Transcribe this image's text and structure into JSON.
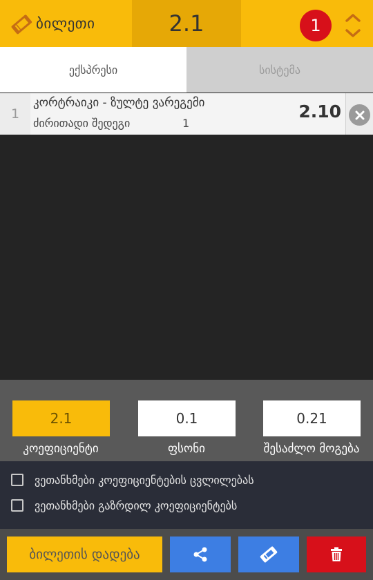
{
  "header": {
    "title": "ბილეთი",
    "total_odds": "2.1",
    "bet_count": "1"
  },
  "tabs": [
    {
      "label": "ექსპრესი",
      "active": true
    },
    {
      "label": "სისტემა",
      "active": false
    }
  ],
  "bets": [
    {
      "index": "1",
      "match": "კორტრაიკი - ზულტე ვარეგემი",
      "market": "ძირითადი შედეგი",
      "outcome": "1",
      "odds": "2.10"
    }
  ],
  "stake_panel": {
    "coefficient": {
      "value": "2.1",
      "label": "კოეფიციენტი"
    },
    "stake": {
      "value": "0.1",
      "label": "ფსონი"
    },
    "possible_win": {
      "value": "0.21",
      "label": "შესაძლო მოგება"
    }
  },
  "options": [
    {
      "label": "ვეთანხმები კოეფიციენტების ცვლილებას",
      "checked": false
    },
    {
      "label": "ვეთანხმები გაზრდილ კოეფიციენტებს",
      "checked": false
    }
  ],
  "actions": {
    "place_bet_label": "ბილეთის დადება",
    "share_icon": "share-icon",
    "ticket_icon": "ticket-icon",
    "delete_icon": "trash-icon"
  },
  "colors": {
    "accent_yellow": "#f9bb0a",
    "badge_red": "#d7101a",
    "button_blue": "#3d7ee3"
  }
}
